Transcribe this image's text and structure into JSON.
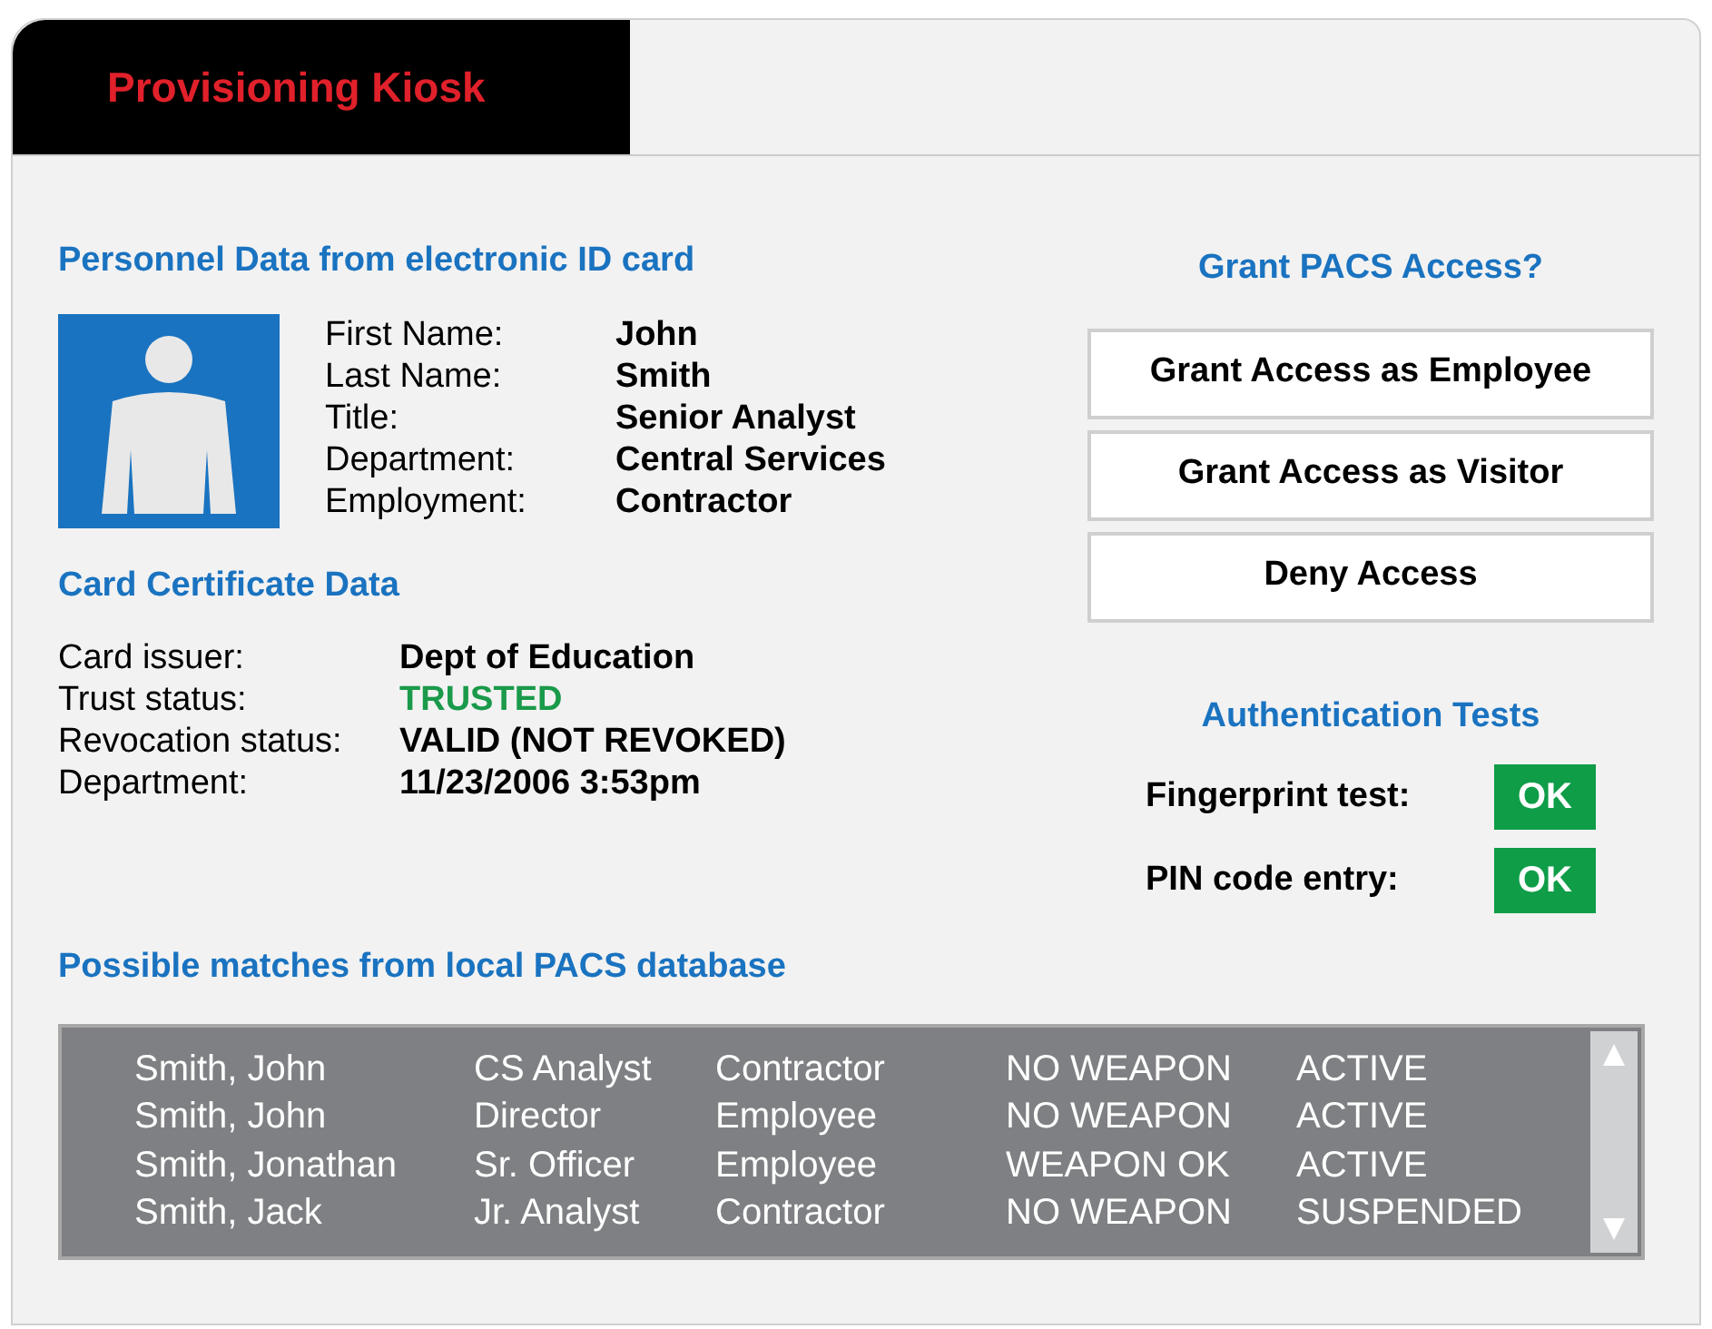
{
  "window": {
    "title": "Provisioning Kiosk"
  },
  "personnel": {
    "heading": "Personnel Data from electronic ID card",
    "fields": [
      {
        "label": "First Name:",
        "value": "John"
      },
      {
        "label": "Last Name:",
        "value": "Smith"
      },
      {
        "label": "Title:",
        "value": "Senior Analyst"
      },
      {
        "label": "Department:",
        "value": "Central Services"
      },
      {
        "label": "Employment:",
        "value": "Contractor"
      }
    ]
  },
  "certificate": {
    "heading": "Card Certificate Data",
    "fields": [
      {
        "label": "Card issuer:",
        "value": "Dept of Education",
        "kind": "plain"
      },
      {
        "label": "Trust status:",
        "value": "TRUSTED",
        "kind": "good"
      },
      {
        "label": "Revocation status:",
        "value": "VALID (NOT REVOKED)",
        "kind": "plain"
      },
      {
        "label": "Department:",
        "value": "11/23/2006 3:53pm",
        "kind": "plain"
      }
    ]
  },
  "grant": {
    "heading": "Grant PACS Access?",
    "buttons": [
      "Grant Access as Employee",
      "Grant Access as Visitor",
      "Deny Access"
    ]
  },
  "tests": {
    "heading": "Authentication Tests",
    "items": [
      {
        "label": "Fingerprint test:",
        "result": "OK"
      },
      {
        "label": "PIN code entry:",
        "result": "OK"
      }
    ]
  },
  "matches": {
    "heading": "Possible matches from local PACS database",
    "rows": [
      [
        "Smith, John",
        "CS Analyst",
        "Contractor",
        "NO WEAPON",
        "ACTIVE"
      ],
      [
        "Smith, John",
        "Director",
        "Employee",
        "NO WEAPON",
        "ACTIVE"
      ],
      [
        "Smith, Jonathan",
        "Sr. Officer",
        "Employee",
        "WEAPON OK",
        "ACTIVE"
      ],
      [
        "Smith, Jack",
        "Jr. Analyst",
        "Contractor",
        "NO WEAPON",
        "SUSPENDED"
      ]
    ]
  }
}
